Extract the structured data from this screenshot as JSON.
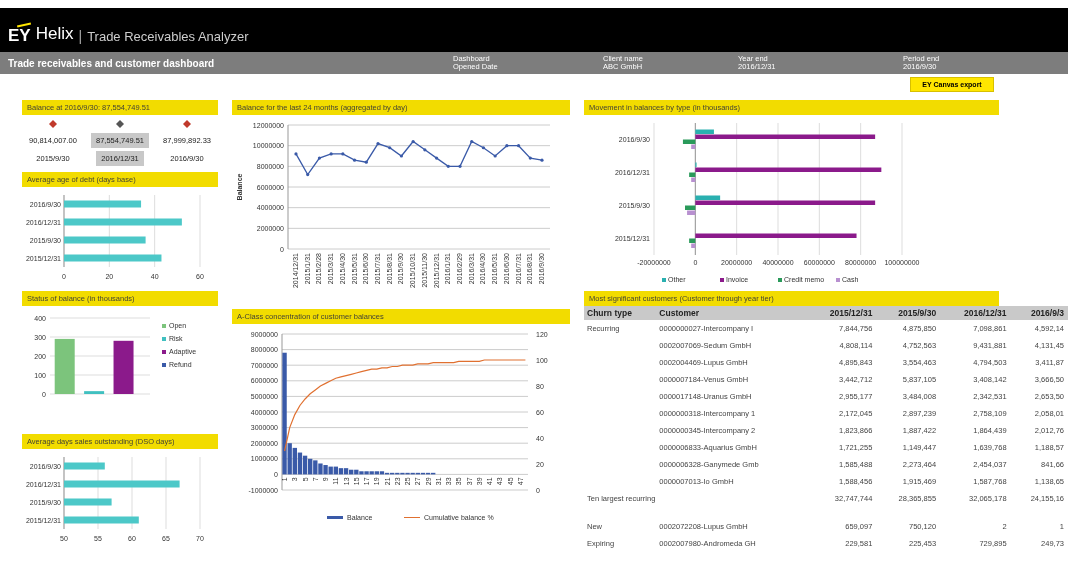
{
  "header": {
    "logo": "EY",
    "product": "Helix",
    "separator": "|",
    "app_title": "Trade Receivables Analyzer"
  },
  "toolbar": {
    "title": "Trade receivables and customer dashboard",
    "fields": [
      {
        "label": "Dashboard",
        "value": "Opened Date"
      },
      {
        "label": "Client name",
        "value": "ABC GmbH"
      },
      {
        "label": "Year end",
        "value": "2016/12/31"
      },
      {
        "label": "Period end",
        "value": "2016/9/30"
      }
    ]
  },
  "export_button": "EY Canvas export",
  "balance_panel": {
    "title": "Balance at 2016/9/30: 87,554,749.51",
    "items": [
      {
        "value": "90,814,007.00",
        "date": "2015/9/30",
        "selected": false,
        "color": "#c0392b"
      },
      {
        "value": "87,554,749.51",
        "date": "2016/12/31",
        "selected": true,
        "color": "#555555"
      },
      {
        "value": "87,999,892.33",
        "date": "2016/9/30",
        "selected": false,
        "color": "#c0392b"
      }
    ]
  },
  "age_panel": {
    "title": "Average age of debt (days base)",
    "chart_data": {
      "type": "bar",
      "orientation": "horizontal",
      "categories": [
        "2016/9/30",
        "2016/12/31",
        "2015/9/30",
        "2015/12/31"
      ],
      "series": [
        {
          "color": "#4cc8c8",
          "values": [
            34,
            52,
            36,
            43
          ]
        }
      ],
      "xticks": [
        0,
        20,
        40,
        60
      ],
      "xlim": [
        0,
        60
      ],
      "grid": true
    }
  },
  "status_panel": {
    "title": "Status of balance (in thousands)",
    "chart_data": {
      "type": "bar",
      "ylim": [
        0,
        400
      ],
      "grid": true,
      "legend": "right",
      "series": [
        {
          "name": "Open",
          "color": "#7cc47c",
          "values": [
            290
          ]
        },
        {
          "name": "Risk",
          "color": "#40c0c0",
          "values": [
            15
          ]
        },
        {
          "name": "Adaptive",
          "color": "#8b1a8b",
          "values": [
            280
          ]
        },
        {
          "name": "Refund",
          "color": "#3a5aa8",
          "values": [
            null
          ]
        }
      ],
      "yticks": [
        0,
        100,
        200,
        300,
        400
      ]
    }
  },
  "dso_panel": {
    "title": "Average days sales outstanding (DSO days)",
    "chart_data": {
      "type": "bar",
      "orientation": "horizontal",
      "categories": [
        "2016/9/30",
        "2016/12/31",
        "2015/9/30",
        "2015/12/31"
      ],
      "series": [
        {
          "color": "#4cc8c8",
          "values": [
            56,
            67,
            57,
            61
          ]
        }
      ],
      "xticks": [
        50,
        55,
        60,
        65,
        70
      ],
      "xlim": [
        50,
        70
      ],
      "grid": true
    }
  },
  "balance_chart_panel": {
    "title": "Balance for the last 24 months (aggregated by day)",
    "chart_data": {
      "type": "line",
      "ylabel": "Balance",
      "categories": [
        "2014/12/31",
        "2015/1/31",
        "2015/2/28",
        "2015/3/31",
        "2015/4/30",
        "2015/5/31",
        "2015/6/30",
        "2015/7/31",
        "2015/8/31",
        "2015/9/30",
        "2015/10/31",
        "2015/11/30",
        "2015/12/31",
        "2016/1/31",
        "2016/2/29",
        "2016/3/31",
        "2016/4/30",
        "2016/5/31",
        "2016/6/30",
        "2016/7/31",
        "2016/8/31",
        "2016/9/30"
      ],
      "series": [
        {
          "color": "#3a5aa8",
          "values": [
            9200000,
            7200000,
            8800000,
            9200000,
            9200000,
            8600000,
            8400000,
            10200000,
            9800000,
            9000000,
            10400000,
            9600000,
            8800000,
            8000000,
            8000000,
            10400000,
            9800000,
            9000000,
            10000000,
            10000000,
            8800000,
            8600000
          ]
        }
      ],
      "yticks": [
        0,
        2000000,
        4000000,
        6000000,
        8000000,
        10000000,
        12000000
      ],
      "ylim": [
        0,
        12000000
      ],
      "grid": true
    }
  },
  "pareto_panel": {
    "title": "A-Class concentration of customer balances",
    "chart_data": {
      "type": "bar",
      "x": [
        1,
        2,
        3,
        4,
        5,
        6,
        7,
        8,
        9,
        10,
        11,
        12,
        13,
        14,
        15,
        16,
        17,
        18,
        19,
        20,
        21,
        22,
        23,
        24,
        25,
        26,
        27,
        28,
        29,
        30,
        31,
        32,
        33,
        34,
        35,
        36,
        37,
        38,
        39,
        40,
        41,
        42,
        43,
        44,
        45,
        46,
        47,
        48
      ],
      "xticks": [
        1,
        3,
        5,
        7,
        9,
        11,
        13,
        15,
        17,
        19,
        21,
        23,
        25,
        27,
        29,
        31,
        33,
        35,
        37,
        39,
        41,
        43,
        45,
        47
      ],
      "series": [
        {
          "name": "Balance",
          "color": "#3a5aa8",
          "values": [
            7800000,
            2000000,
            1700000,
            1400000,
            1200000,
            1000000,
            900000,
            700000,
            600000,
            500000,
            500000,
            400000,
            400000,
            300000,
            300000,
            200000,
            200000,
            200000,
            200000,
            200000,
            100000,
            100000,
            100000,
            100000,
            100000,
            100000,
            100000,
            100000,
            100000,
            100000,
            0,
            0,
            0,
            0,
            0,
            0,
            0,
            0,
            0,
            0,
            0,
            0,
            0,
            0,
            0,
            0,
            0,
            0
          ]
        },
        {
          "name": "Cumulative balance %",
          "color": "#e07030",
          "type": "line",
          "axis": "y2",
          "values": [
            30,
            48,
            58,
            65,
            70,
            74,
            77,
            80,
            82,
            84,
            86,
            87,
            88,
            89,
            90,
            91,
            92,
            93,
            93,
            94,
            94,
            95,
            95,
            96,
            96,
            96,
            97,
            97,
            97,
            98,
            98,
            98,
            98,
            98,
            99,
            99,
            99,
            99,
            99,
            100,
            100,
            100,
            100,
            100,
            100,
            100,
            100,
            100
          ]
        }
      ],
      "yticks": [
        -1000000,
        0,
        1000000,
        2000000,
        3000000,
        4000000,
        5000000,
        6000000,
        7000000,
        8000000,
        9000000
      ],
      "ylim": [
        -1000000,
        9000000
      ],
      "y2ticks": [
        0,
        20,
        40,
        60,
        80,
        100,
        120
      ],
      "y2lim": [
        0,
        120
      ],
      "xlim": [
        0.5,
        48.5
      ],
      "grid": true,
      "legend": "bottom"
    }
  },
  "movement_panel": {
    "title": "Movement in balances by type (in thousands)",
    "chart_data": {
      "type": "bar",
      "orientation": "horizontal",
      "categories": [
        "2016/9/30",
        "2016/12/31",
        "2015/9/30",
        "2015/12/31"
      ],
      "series": [
        {
          "name": "Other",
          "color": "#2ab0b0",
          "values": [
            9000000,
            600000,
            12000000,
            0
          ]
        },
        {
          "name": "Invoice",
          "color": "#8b1a8b",
          "values": [
            87000000,
            90000000,
            87000000,
            78000000
          ]
        },
        {
          "name": "Credit memo",
          "color": "#2a9a5a",
          "values": [
            -6000000,
            -3000000,
            -5000000,
            -3000000
          ]
        },
        {
          "name": "Cash",
          "color": "#b890d0",
          "values": [
            -2000000,
            -2000000,
            -4000000,
            -2000000
          ]
        }
      ],
      "xticks": [
        -20000000,
        0,
        20000000,
        40000000,
        60000000,
        80000000,
        100000000
      ],
      "xlim": [
        -20000000,
        100000000
      ],
      "grid": true,
      "legend": "bottom"
    }
  },
  "table": {
    "title": "Most significant customers (Customer through year tier)",
    "columns": [
      "Churn type",
      "Customer",
      "2015/12/31",
      "2015/9/30",
      "2016/12/31",
      "2016/9/3"
    ],
    "rows": [
      {
        "kind": "customer",
        "churn_type": "Recurring",
        "customer": "0000000027-Intercompany I",
        "values": [
          "7,844,756",
          "4,875,850",
          "7,098,861",
          "4,592,14"
        ]
      },
      {
        "kind": "customer",
        "customer": "0002007069-Sedum GmbH",
        "values": [
          "4,808,114",
          "4,752,563",
          "9,431,881",
          "4,131,45"
        ]
      },
      {
        "kind": "customer",
        "customer": "0002004469-Lupus GmbH",
        "values": [
          "4,895,843",
          "3,554,463",
          "4,794,503",
          "3,411,87"
        ]
      },
      {
        "kind": "customer",
        "customer": "0000007184-Venus GmbH",
        "values": [
          "3,442,712",
          "5,837,105",
          "3,408,142",
          "3,666,50"
        ]
      },
      {
        "kind": "customer",
        "customer": "0000017148-Uranus GmbH",
        "values": [
          "2,955,177",
          "3,484,008",
          "2,342,531",
          "2,653,50"
        ]
      },
      {
        "kind": "customer",
        "customer": "0000000318-Intercompany 1",
        "values": [
          "2,172,045",
          "2,897,239",
          "2,758,109",
          "2,058,01"
        ]
      },
      {
        "kind": "customer",
        "customer": "0000000345-Intercompany 2",
        "values": [
          "1,823,866",
          "1,887,422",
          "1,864,439",
          "2,012,76"
        ]
      },
      {
        "kind": "customer",
        "customer": "0000006833-Aquarius GmbH",
        "values": [
          "1,721,255",
          "1,149,447",
          "1,639,768",
          "1,188,57"
        ]
      },
      {
        "kind": "customer",
        "customer": "0000006328-Ganymede Gmb",
        "values": [
          "1,585,488",
          "2,273,464",
          "2,454,037",
          "841,66"
        ]
      },
      {
        "kind": "customer",
        "customer": "0000007013-Io GmbH",
        "values": [
          "1,588,456",
          "1,915,469",
          "1,587,768",
          "1,138,65"
        ]
      },
      {
        "kind": "total",
        "churn_type": "Ten largest recurring",
        "values": [
          "32,747,744",
          "28,365,855",
          "32,065,178",
          "24,155,16"
        ]
      },
      {
        "kind": "customer",
        "churn_type": "New",
        "customer": "0002072208-Lupus GmbH",
        "values": [
          "659,097",
          "750,120",
          "2",
          "1"
        ]
      },
      {
        "kind": "customer",
        "churn_type": "Expiring",
        "customer": "0002007980-Andromeda GH",
        "values": [
          "229,581",
          "225,453",
          "729,895",
          "249,73"
        ]
      }
    ]
  }
}
